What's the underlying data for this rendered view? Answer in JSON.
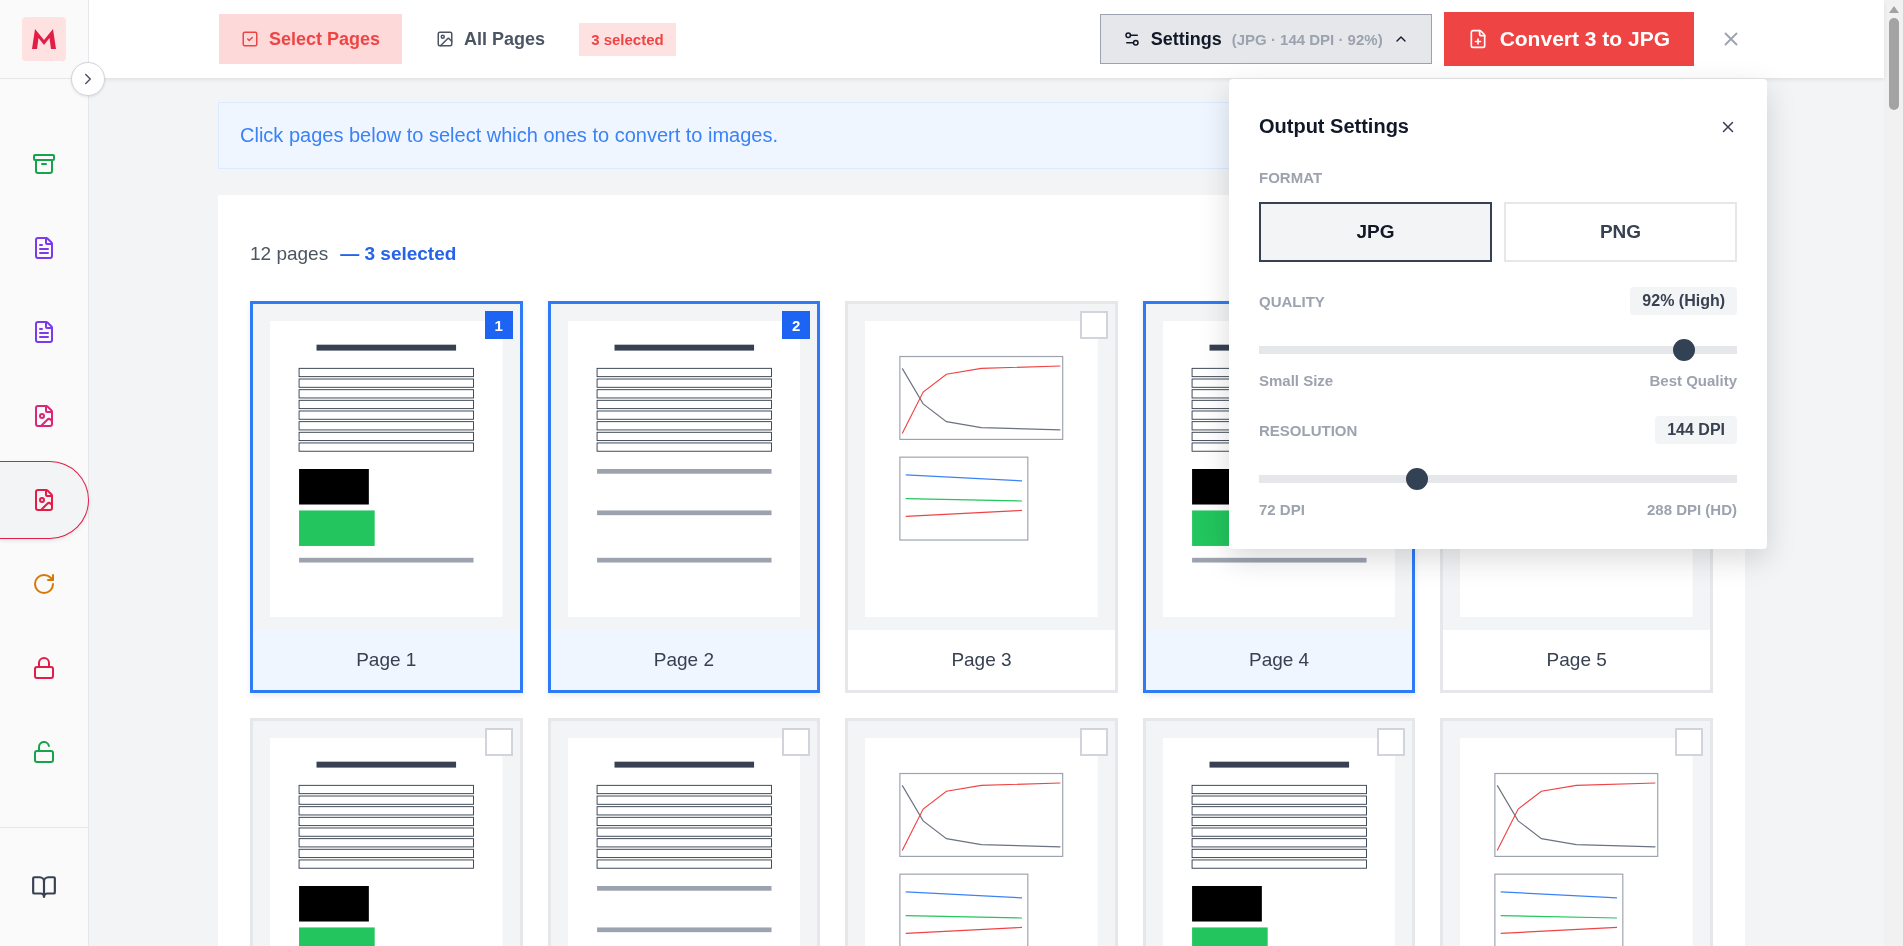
{
  "sidebar": {
    "items": [
      {
        "color": "#16a34a",
        "selected": false
      },
      {
        "color": "#7c3aed",
        "selected": false
      },
      {
        "color": "#7c3aed",
        "selected": false
      },
      {
        "color": "#db2777",
        "selected": false
      },
      {
        "color": "#e11d48",
        "selected": true
      },
      {
        "color": "#d97706",
        "selected": false
      },
      {
        "color": "#e11d48",
        "selected": false
      },
      {
        "color": "#16a34a",
        "selected": false
      }
    ]
  },
  "toolbar": {
    "modes": [
      {
        "label": "Select Pages",
        "selected": true
      },
      {
        "label": "All Pages",
        "selected": false
      }
    ],
    "selection_badge": "3 selected",
    "settings": {
      "label": "Settings",
      "summary": "(JPG · 144 DPI · 92%)",
      "expanded": true
    },
    "convert_button": "Convert 3 to JPG"
  },
  "banner": "Click pages below to select which ones to convert to images.",
  "pages_summary": {
    "count": "12 pages",
    "selected": "— 3 selected"
  },
  "pages": [
    {
      "label": "Page 1",
      "selected": true,
      "badge": "1"
    },
    {
      "label": "Page 2",
      "selected": true,
      "badge": "2"
    },
    {
      "label": "Page 3",
      "selected": false
    },
    {
      "label": "Page 4",
      "selected": true
    },
    {
      "label": "Page 5",
      "selected": false
    },
    {
      "selected": false
    },
    {
      "selected": false
    },
    {
      "selected": false
    },
    {
      "selected": false
    },
    {
      "selected": false
    }
  ],
  "output_settings": {
    "title": "Output Settings",
    "format": {
      "label": "FORMAT",
      "options": [
        {
          "label": "JPG",
          "selected": true
        },
        {
          "label": "PNG",
          "selected": false
        }
      ]
    },
    "quality": {
      "label": "QUALITY",
      "reading": "92% (High)",
      "level": 0.89,
      "min_label": "Small Size",
      "max_label": "Best Quality"
    },
    "resolution": {
      "label": "RESOLUTION",
      "reading": "144 DPI",
      "level": 0.33,
      "min_label": "72 DPI",
      "max_label": "288 DPI (HD)"
    }
  }
}
